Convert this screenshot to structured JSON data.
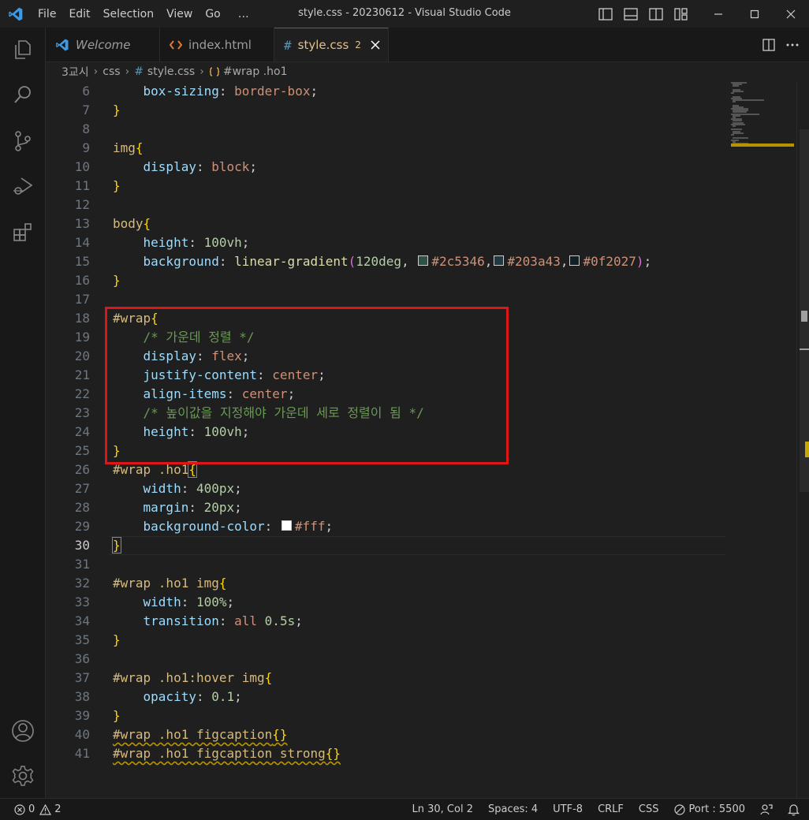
{
  "window": {
    "title": "style.css - 20230612 - Visual Studio Code",
    "menu": [
      "File",
      "Edit",
      "Selection",
      "View",
      "Go",
      "…"
    ]
  },
  "tabs": [
    {
      "label": "Welcome",
      "icon": "vscode-logo-icon"
    },
    {
      "label": "index.html",
      "icon": "html-file-icon"
    },
    {
      "label": "style.css",
      "icon": "css-file-icon",
      "problems": "2",
      "active": true
    }
  ],
  "breadcrumb": [
    "3교시",
    "css",
    "style.css",
    "#wrap .ho1"
  ],
  "editor": {
    "cursor_line": 30,
    "lines": [
      {
        "n": "6",
        "tokens": [
          {
            "t": "    ",
            "c": ""
          },
          {
            "t": "box-sizing",
            "c": "t-prop"
          },
          {
            "t": ": ",
            "c": "t-punc"
          },
          {
            "t": "border-box",
            "c": "t-val"
          },
          {
            "t": ";",
            "c": "t-punc"
          }
        ]
      },
      {
        "n": "7",
        "tokens": [
          {
            "t": "}",
            "c": "t-brace"
          }
        ]
      },
      {
        "n": "8",
        "tokens": []
      },
      {
        "n": "9",
        "tokens": [
          {
            "t": "img",
            "c": "t-sel"
          },
          {
            "t": "{",
            "c": "t-brace"
          }
        ]
      },
      {
        "n": "10",
        "tokens": [
          {
            "t": "    ",
            "c": ""
          },
          {
            "t": "display",
            "c": "t-prop"
          },
          {
            "t": ": ",
            "c": "t-punc"
          },
          {
            "t": "block",
            "c": "t-val"
          },
          {
            "t": ";",
            "c": "t-punc"
          }
        ]
      },
      {
        "n": "11",
        "tokens": [
          {
            "t": "}",
            "c": "t-brace"
          }
        ]
      },
      {
        "n": "12",
        "tokens": []
      },
      {
        "n": "13",
        "tokens": [
          {
            "t": "body",
            "c": "t-sel"
          },
          {
            "t": "{",
            "c": "t-brace"
          }
        ]
      },
      {
        "n": "14",
        "tokens": [
          {
            "t": "    ",
            "c": ""
          },
          {
            "t": "height",
            "c": "t-prop"
          },
          {
            "t": ": ",
            "c": "t-punc"
          },
          {
            "t": "100vh",
            "c": "t-num"
          },
          {
            "t": ";",
            "c": "t-punc"
          }
        ]
      },
      {
        "n": "15",
        "tokens": [
          {
            "t": "    ",
            "c": ""
          },
          {
            "t": "background",
            "c": "t-prop"
          },
          {
            "t": ": ",
            "c": "t-punc"
          },
          {
            "t": "linear-gradient",
            "c": "t-fn"
          },
          {
            "t": "(",
            "c": "t-paren"
          },
          {
            "t": "120deg",
            "c": "t-num"
          },
          {
            "t": ", ",
            "c": "t-punc"
          },
          {
            "t": "",
            "c": "swatch",
            "color": "#2c5346"
          },
          {
            "t": "#2c5346",
            "c": "t-val"
          },
          {
            "t": ",",
            "c": "t-punc"
          },
          {
            "t": "",
            "c": "swatch",
            "color": "#203a43"
          },
          {
            "t": "#203a43",
            "c": "t-val"
          },
          {
            "t": ",",
            "c": "t-punc"
          },
          {
            "t": "",
            "c": "swatch",
            "color": "#0f2027"
          },
          {
            "t": "#0f2027",
            "c": "t-val"
          },
          {
            "t": ")",
            "c": "t-paren"
          },
          {
            "t": ";",
            "c": "t-punc"
          }
        ]
      },
      {
        "n": "16",
        "tokens": [
          {
            "t": "}",
            "c": "t-brace"
          }
        ]
      },
      {
        "n": "17",
        "tokens": []
      },
      {
        "n": "18",
        "tokens": [
          {
            "t": "#wrap",
            "c": "t-sel"
          },
          {
            "t": "{",
            "c": "t-brace"
          }
        ]
      },
      {
        "n": "19",
        "tokens": [
          {
            "t": "    ",
            "c": ""
          },
          {
            "t": "/* 가운데 정렬 */",
            "c": "t-com"
          }
        ]
      },
      {
        "n": "20",
        "tokens": [
          {
            "t": "    ",
            "c": ""
          },
          {
            "t": "display",
            "c": "t-prop"
          },
          {
            "t": ": ",
            "c": "t-punc"
          },
          {
            "t": "flex",
            "c": "t-val"
          },
          {
            "t": ";",
            "c": "t-punc"
          }
        ]
      },
      {
        "n": "21",
        "tokens": [
          {
            "t": "    ",
            "c": ""
          },
          {
            "t": "justify-content",
            "c": "t-prop"
          },
          {
            "t": ": ",
            "c": "t-punc"
          },
          {
            "t": "center",
            "c": "t-val"
          },
          {
            "t": ";",
            "c": "t-punc"
          }
        ]
      },
      {
        "n": "22",
        "tokens": [
          {
            "t": "    ",
            "c": ""
          },
          {
            "t": "align-items",
            "c": "t-prop"
          },
          {
            "t": ": ",
            "c": "t-punc"
          },
          {
            "t": "center",
            "c": "t-val"
          },
          {
            "t": ";",
            "c": "t-punc"
          }
        ]
      },
      {
        "n": "23",
        "tokens": [
          {
            "t": "    ",
            "c": ""
          },
          {
            "t": "/* 높이값을 지정해야 가운데 세로 정렬이 됨 */",
            "c": "t-com"
          }
        ]
      },
      {
        "n": "24",
        "tokens": [
          {
            "t": "    ",
            "c": ""
          },
          {
            "t": "height",
            "c": "t-prop"
          },
          {
            "t": ": ",
            "c": "t-punc"
          },
          {
            "t": "100vh",
            "c": "t-num"
          },
          {
            "t": ";",
            "c": "t-punc"
          }
        ]
      },
      {
        "n": "25",
        "tokens": [
          {
            "t": "}",
            "c": "t-brace"
          }
        ]
      },
      {
        "n": "26",
        "tokens": [
          {
            "t": "#wrap .ho1",
            "c": "t-sel"
          },
          {
            "t": "{",
            "c": "t-brace bracket-box"
          }
        ]
      },
      {
        "n": "27",
        "tokens": [
          {
            "t": "    ",
            "c": ""
          },
          {
            "t": "width",
            "c": "t-prop"
          },
          {
            "t": ": ",
            "c": "t-punc"
          },
          {
            "t": "400px",
            "c": "t-num"
          },
          {
            "t": ";",
            "c": "t-punc"
          }
        ]
      },
      {
        "n": "28",
        "tokens": [
          {
            "t": "    ",
            "c": ""
          },
          {
            "t": "margin",
            "c": "t-prop"
          },
          {
            "t": ": ",
            "c": "t-punc"
          },
          {
            "t": "20px",
            "c": "t-num"
          },
          {
            "t": ";",
            "c": "t-punc"
          }
        ]
      },
      {
        "n": "29",
        "tokens": [
          {
            "t": "    ",
            "c": ""
          },
          {
            "t": "background-color",
            "c": "t-prop"
          },
          {
            "t": ": ",
            "c": "t-punc"
          },
          {
            "t": "",
            "c": "swatch",
            "color": "#ffffff"
          },
          {
            "t": "#fff",
            "c": "t-val"
          },
          {
            "t": ";",
            "c": "t-punc"
          }
        ]
      },
      {
        "n": "30",
        "tokens": [
          {
            "t": "}",
            "c": "t-brace bracket-box"
          }
        ]
      },
      {
        "n": "31",
        "tokens": []
      },
      {
        "n": "32",
        "tokens": [
          {
            "t": "#wrap .ho1 img",
            "c": "t-sel"
          },
          {
            "t": "{",
            "c": "t-brace"
          }
        ]
      },
      {
        "n": "33",
        "tokens": [
          {
            "t": "    ",
            "c": ""
          },
          {
            "t": "width",
            "c": "t-prop"
          },
          {
            "t": ": ",
            "c": "t-punc"
          },
          {
            "t": "100%",
            "c": "t-num"
          },
          {
            "t": ";",
            "c": "t-punc"
          }
        ]
      },
      {
        "n": "34",
        "tokens": [
          {
            "t": "    ",
            "c": ""
          },
          {
            "t": "transition",
            "c": "t-prop"
          },
          {
            "t": ": ",
            "c": "t-punc"
          },
          {
            "t": "all",
            "c": "t-val"
          },
          {
            "t": " ",
            "c": ""
          },
          {
            "t": "0.5s",
            "c": "t-num"
          },
          {
            "t": ";",
            "c": "t-punc"
          }
        ]
      },
      {
        "n": "35",
        "tokens": [
          {
            "t": "}",
            "c": "t-brace"
          }
        ]
      },
      {
        "n": "36",
        "tokens": []
      },
      {
        "n": "37",
        "tokens": [
          {
            "t": "#wrap .ho1:hover img",
            "c": "t-sel"
          },
          {
            "t": "{",
            "c": "t-brace"
          }
        ]
      },
      {
        "n": "38",
        "tokens": [
          {
            "t": "    ",
            "c": ""
          },
          {
            "t": "opacity",
            "c": "t-prop"
          },
          {
            "t": ": ",
            "c": "t-punc"
          },
          {
            "t": "0.1",
            "c": "t-num"
          },
          {
            "t": ";",
            "c": "t-punc"
          }
        ]
      },
      {
        "n": "39",
        "tokens": [
          {
            "t": "}",
            "c": "t-brace"
          }
        ]
      },
      {
        "n": "40",
        "tokens": [
          {
            "t": "#wrap .ho1 figcaption",
            "c": "t-sel squig"
          },
          {
            "t": "{}",
            "c": "t-brace squig"
          }
        ]
      },
      {
        "n": "41",
        "tokens": [
          {
            "t": "#wrap .ho1 figcaption strong",
            "c": "t-sel squig"
          },
          {
            "t": "{}",
            "c": "t-brace squig"
          }
        ]
      }
    ]
  },
  "status": {
    "errors": "0",
    "warnings": "2",
    "position": "Ln 30, Col 2",
    "spaces": "Spaces: 4",
    "encoding": "UTF-8",
    "eol": "CRLF",
    "language": "CSS",
    "port": "Port : 5500"
  },
  "colors": {
    "accent": "#0078d4",
    "highlight_box": "#e01616"
  }
}
